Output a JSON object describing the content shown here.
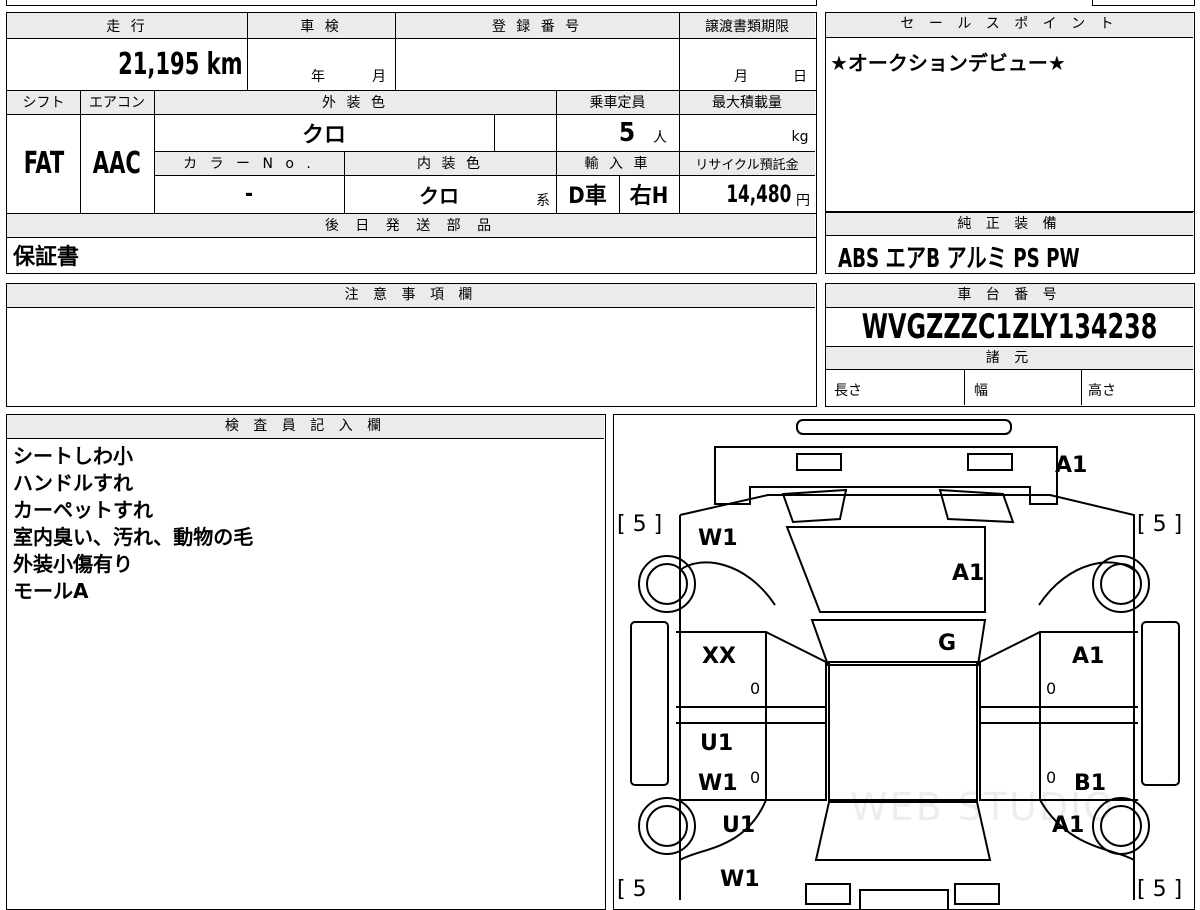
{
  "top_left": {
    "headers": {
      "mileage": "走 行",
      "inspection": "車 検",
      "registration": "登 録 番 号",
      "deadline": "譲渡書類期限",
      "shift": "シフト",
      "aircon": "エアコン",
      "exterior": "外 装 色",
      "capacity": "乗車定員",
      "load": "最大積載量",
      "color_no": "カ ラ ー N o .",
      "interior": "内 装 色",
      "import": "輸 入 車",
      "recycle": "リサイクル預託金"
    },
    "mileage_value": "21,195 km",
    "inspection_year": "年",
    "inspection_month": "月",
    "deadline_month": "月",
    "deadline_day": "日",
    "shift_value": "FAT",
    "aircon_value": "AAC",
    "exterior_value": "クロ",
    "capacity_value": "5",
    "capacity_unit": "人",
    "load_unit": "kg",
    "color_no_value": "-",
    "interior_value": "クロ",
    "interior_suffix": "系",
    "import_dealer": "D車",
    "import_handle": "右H",
    "recycle_value": "14,480",
    "recycle_unit": "円"
  },
  "later_parts": {
    "title": "後 日 発 送 部 品",
    "value": "保証書"
  },
  "sales_point": {
    "title": "セ ー ル ス ポ イ ン ト",
    "value": "★オークションデビュー★"
  },
  "equipment": {
    "title": "純 正 装 備",
    "value": "ABS エアB アルミ PS PW"
  },
  "caution": {
    "title": "注 意 事 項 欄"
  },
  "chassis": {
    "title": "車 台 番 号",
    "value": "WVGZZZC1ZLY134238",
    "specs_title": "諸 元",
    "length": "長さ",
    "width": "幅",
    "height": "高さ"
  },
  "inspector": {
    "title": "検 査 員 記 入 欄",
    "notes": [
      "シートしわ小",
      "ハンドルすれ",
      "カーペットすれ",
      "室内臭い、汚れ、動物の毛",
      "外装小傷有り",
      "モールA"
    ]
  },
  "car_diagram": {
    "watermark": "WEB STUDIO",
    "marks": {
      "front_bumper": "A1",
      "hood": "A1",
      "front_fender_left": "W1",
      "windshield": "G",
      "front_door_left": "XX",
      "front_door_right": "A1",
      "rear_door_left_1": "U1",
      "rear_door_left_2": "W1",
      "rear_door_right": "B1",
      "rear_fender_left": "U1",
      "rear_fender_right": "A1",
      "rear_left": "W1"
    },
    "tire_front_left": "[ 5 ]",
    "tire_front_right": "[ 5 ]",
    "tire_rear_left": "[ 5",
    "tire_rear_right": "[ 5 ]",
    "zero": "0"
  }
}
